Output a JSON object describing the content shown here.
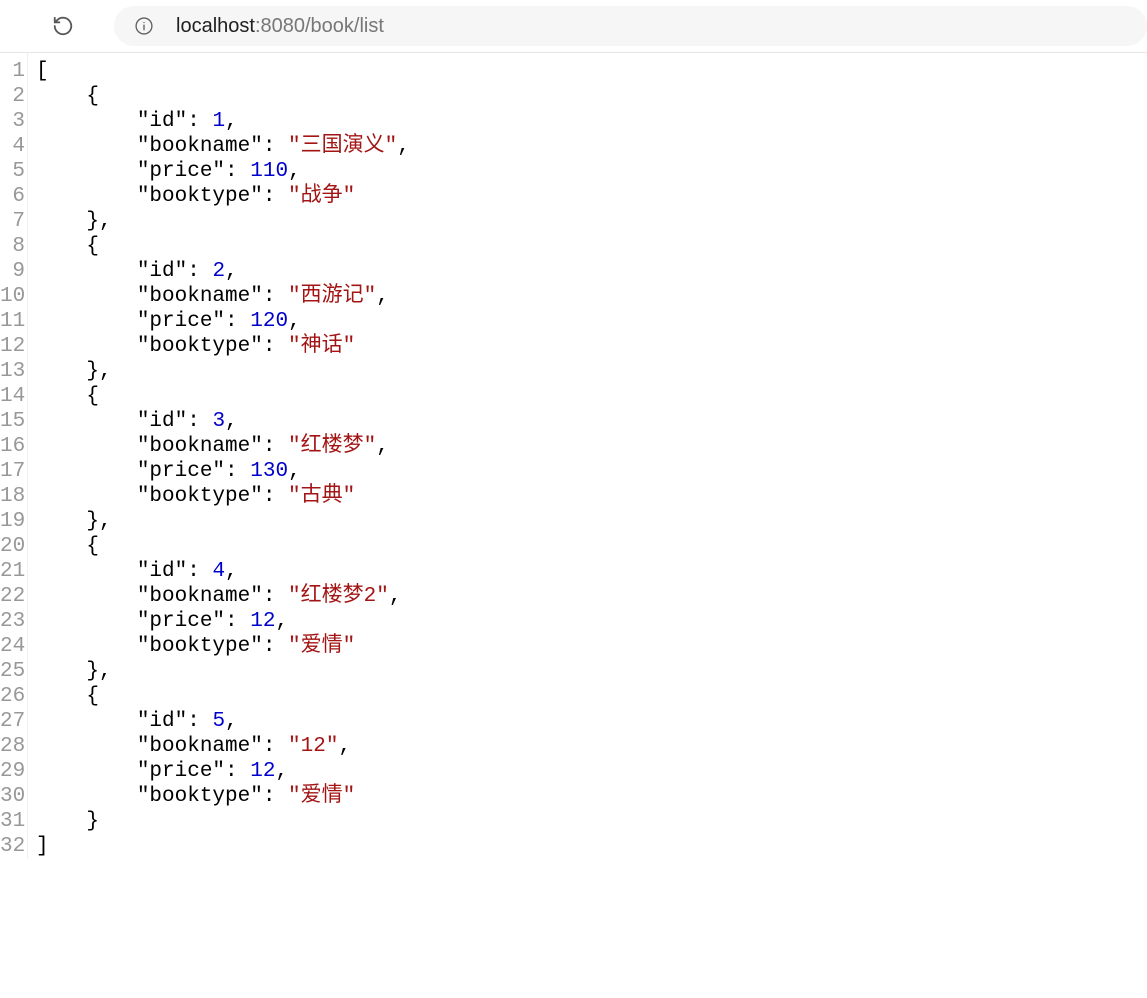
{
  "toolbar": {
    "url_before": "localhost",
    "url_after": ":8080/book/list"
  },
  "json_body": [
    {
      "id": 1,
      "bookname": "三国演义",
      "price": 110,
      "booktype": "战争"
    },
    {
      "id": 2,
      "bookname": "西游记",
      "price": 120,
      "booktype": "神话"
    },
    {
      "id": 3,
      "bookname": "红楼梦",
      "price": 130,
      "booktype": "古典"
    },
    {
      "id": 4,
      "bookname": "红楼梦2",
      "price": 12,
      "booktype": "爱情"
    },
    {
      "id": 5,
      "bookname": "12",
      "price": 12,
      "booktype": "爱情"
    }
  ],
  "field_order": [
    "id",
    "bookname",
    "price",
    "booktype"
  ]
}
